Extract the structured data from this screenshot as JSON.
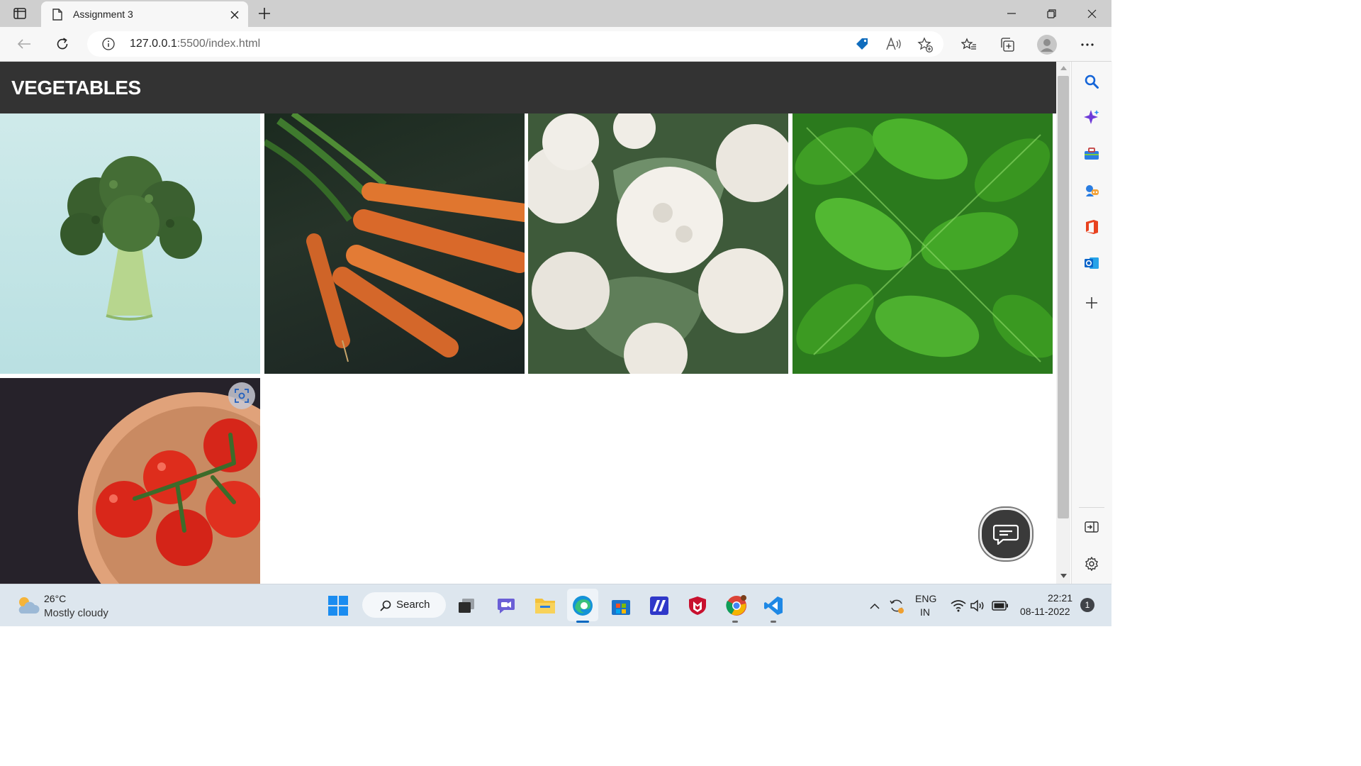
{
  "browser": {
    "tab_title": "Assignment 3",
    "url_host": "127.0.0.1",
    "url_rest": ":5500/index.html"
  },
  "page": {
    "title": "VEGETABLES",
    "images": [
      "broccoli",
      "carrots",
      "cauliflower",
      "spinach",
      "tomatoes"
    ]
  },
  "taskbar": {
    "weather_temp": "26°C",
    "weather_desc": "Mostly cloudy",
    "search_label": "Search",
    "lang_line1": "ENG",
    "lang_line2": "IN",
    "time": "22:21",
    "date": "08-11-2022",
    "notification_count": "1"
  },
  "colors": {
    "header_bg": "#333333",
    "accent_blue": "#0078d4"
  }
}
